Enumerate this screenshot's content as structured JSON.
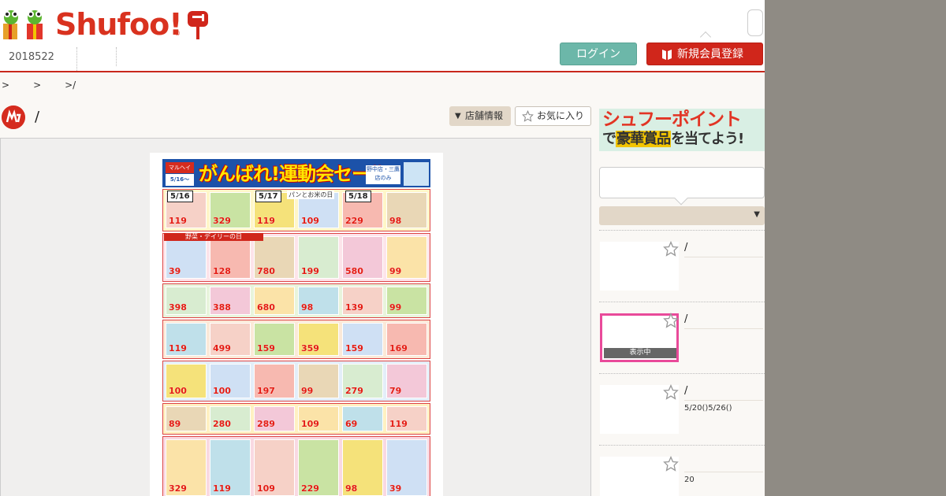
{
  "header": {
    "logo_text": "Shufoo!",
    "logo_reg": "®",
    "date_tab": "2018522",
    "login_label": "ログイン",
    "register_label": "新規会員登録"
  },
  "breadcrumb": [
    ">",
    ">",
    ">/"
  ],
  "store": {
    "title": "/",
    "storeinfo_label": "店舗情報",
    "storeinfo_icon": "▼",
    "favorite_label": "お気に入り"
  },
  "flyer": {
    "title": "がんばれ!運動会セール",
    "logo": "マルヘイ",
    "date": "5/16〜5/22",
    "note": "野中店・三鷹店のみ",
    "days": [
      "5/16",
      "5/17",
      "5/18"
    ],
    "day_heading": "パンとお米の日",
    "section_heading": "野菜・デイリーの日",
    "prices": [
      "119",
      "329",
      "119",
      "109",
      "229",
      "98",
      "39",
      "128",
      "780",
      "199",
      "580",
      "99",
      "398",
      "388",
      "680",
      "98",
      "139",
      "99",
      "119",
      "499",
      "159",
      "359",
      "159",
      "169",
      "100",
      "100",
      "197",
      "99",
      "279",
      "79",
      "89",
      "280",
      "289",
      "109",
      "69"
    ]
  },
  "sidebar": {
    "banner_line1": "シュフーポイント",
    "banner_line2_pre": "で",
    "banner_line2_hl": "豪華賞品",
    "banner_line2_post": "を当てよう!",
    "select_arrow": "▼",
    "items": [
      {
        "title": "/",
        "sub": ""
      },
      {
        "title": "/",
        "sub": "",
        "badge": "表示中"
      },
      {
        "title": "/",
        "sub": "5/20()5/26()"
      },
      {
        "title": "",
        "sub": "20"
      }
    ]
  },
  "colors": {
    "brand": "#d9321f",
    "login": "#6cb7a9",
    "register": "#d0261b",
    "highlight": "#e94a9a"
  }
}
